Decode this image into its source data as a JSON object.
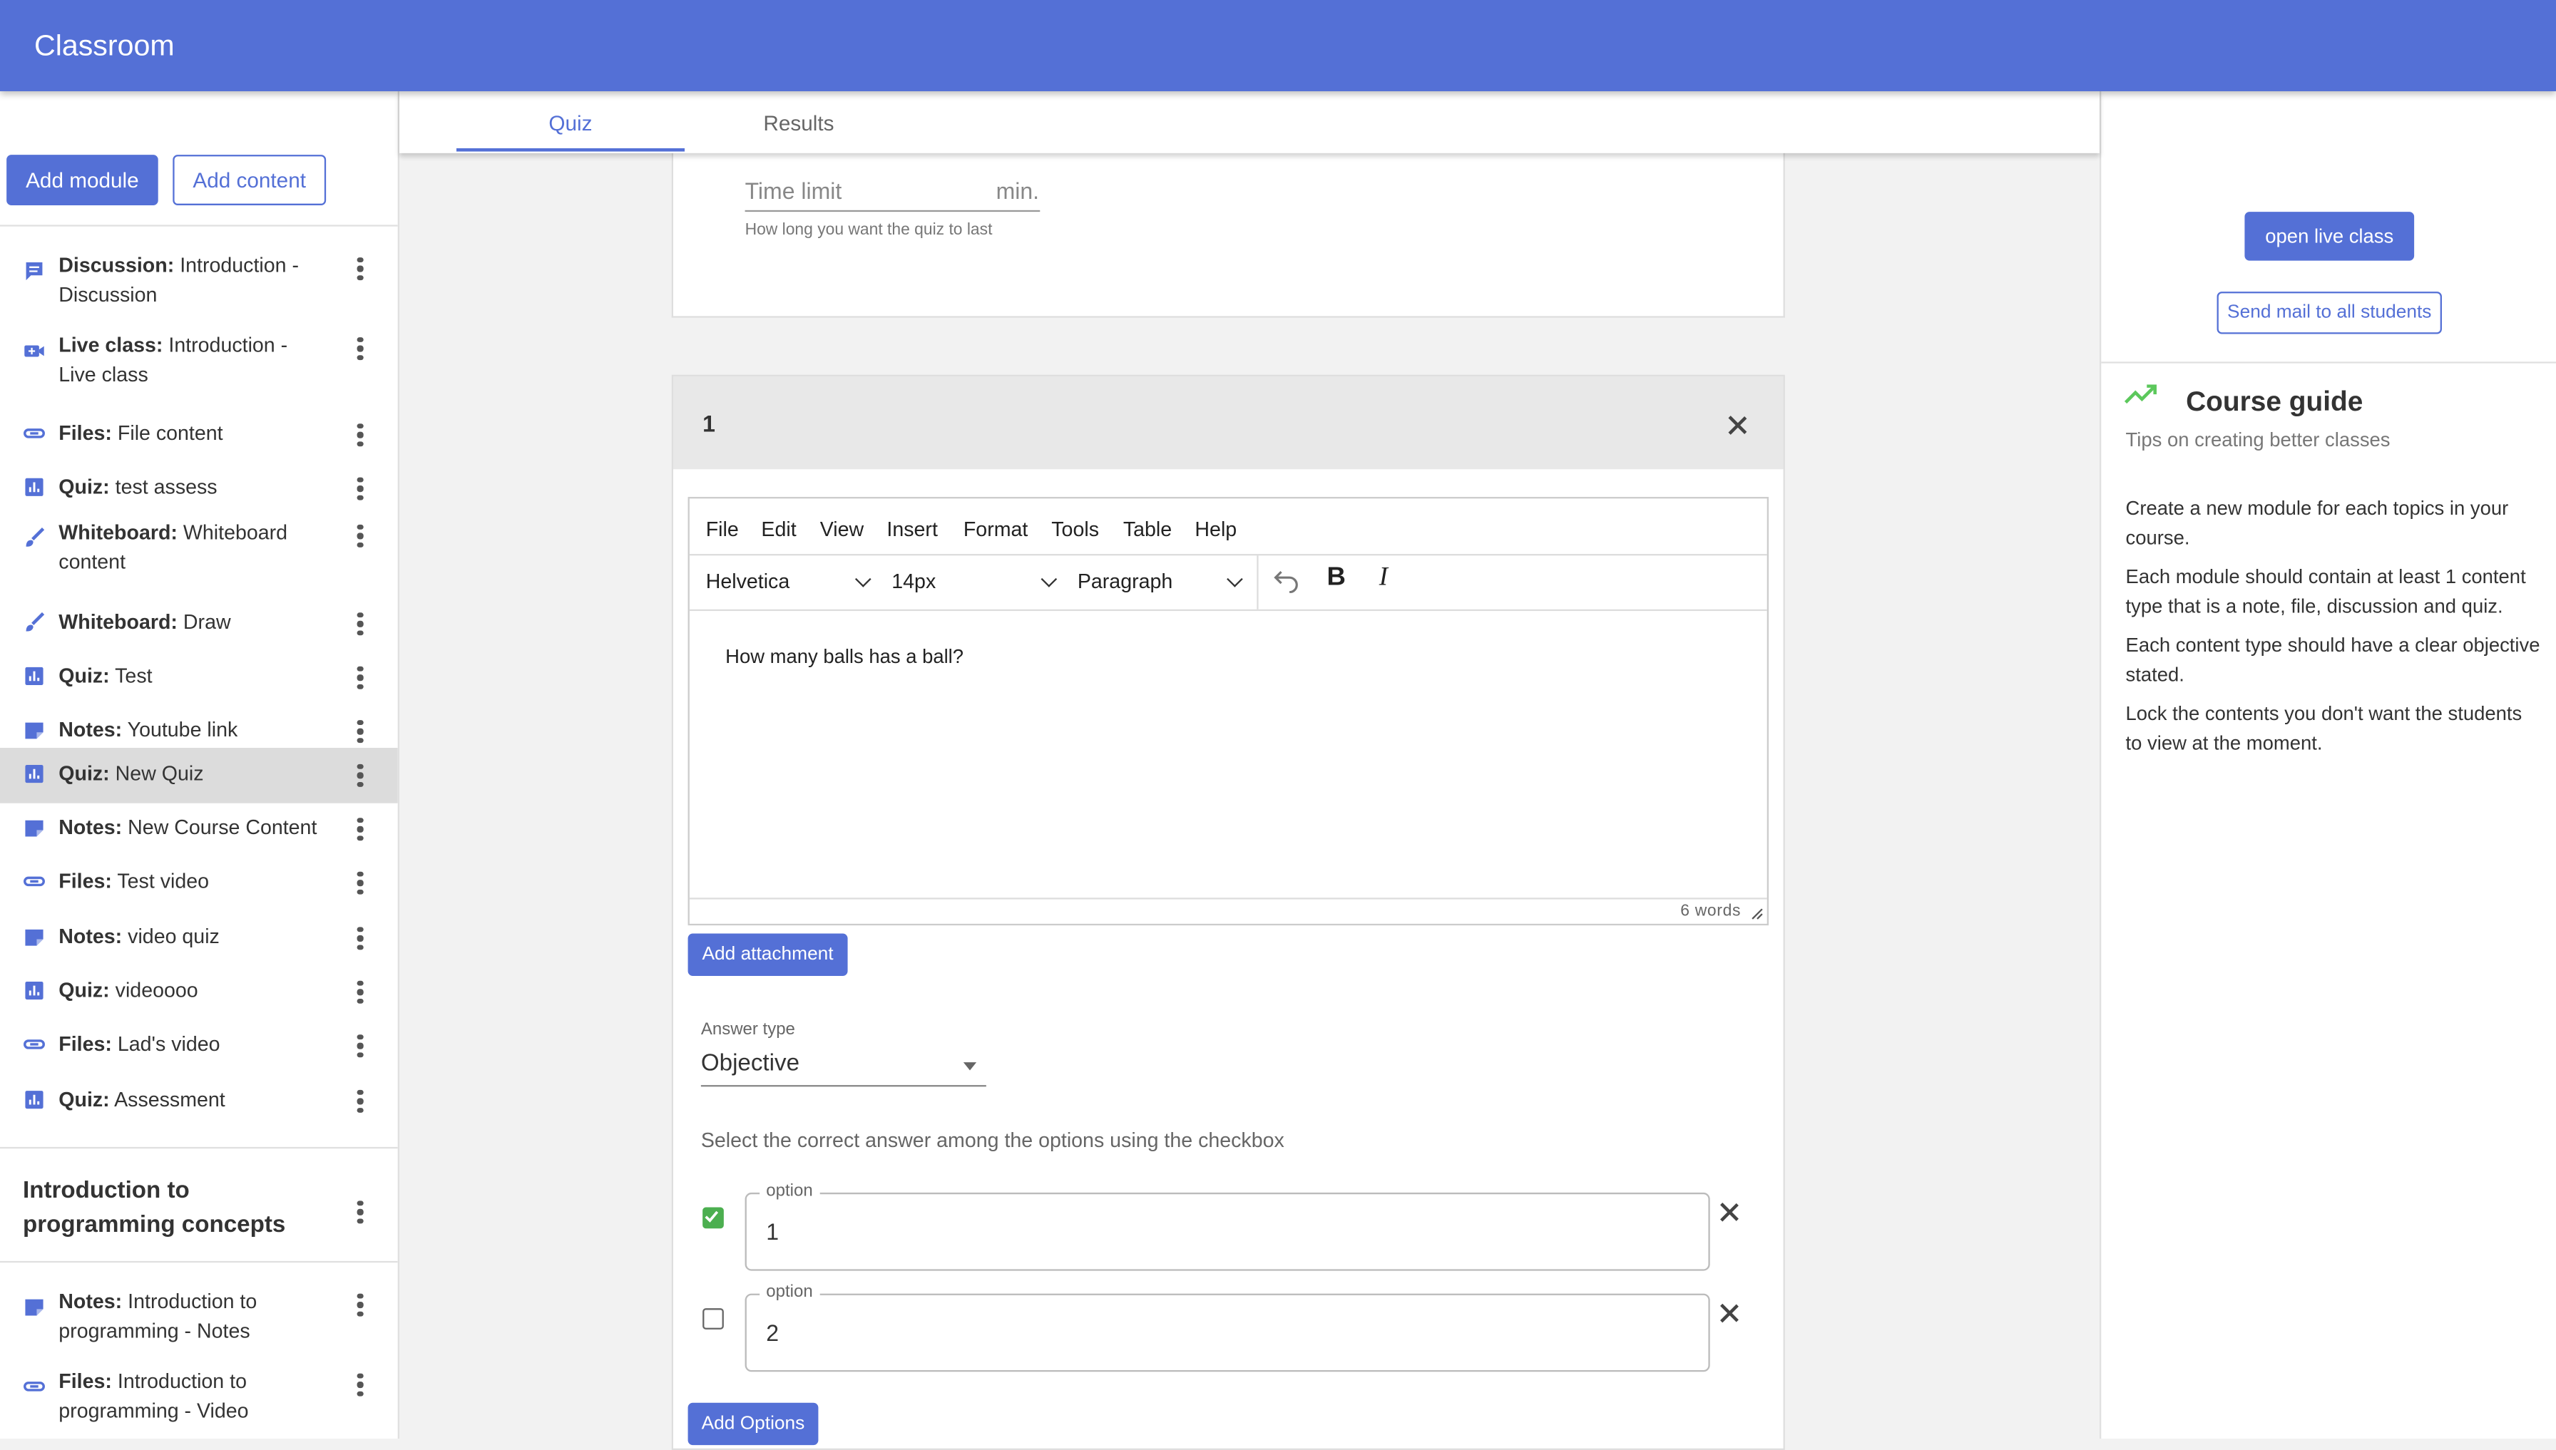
{
  "app": {
    "title": "Classroom"
  },
  "sidebar": {
    "add_module_label": "Add module",
    "add_content_label": "Add content",
    "items": [
      {
        "type": "Discussion:",
        "name": "Introduction - Discussion",
        "icon": "discussion-icon"
      },
      {
        "type": "Live class:",
        "name": "Introduction - Live class",
        "icon": "video-camera-icon"
      },
      {
        "type": "Files:",
        "name": "File content",
        "icon": "link-icon"
      },
      {
        "type": "Quiz:",
        "name": "test assess",
        "icon": "chart-icon"
      },
      {
        "type": "Whiteboard:",
        "name": "Whiteboard content",
        "icon": "brush-icon"
      },
      {
        "type": "Whiteboard:",
        "name": "Draw",
        "icon": "brush-icon"
      },
      {
        "type": "Quiz:",
        "name": "Test",
        "icon": "chart-icon"
      },
      {
        "type": "Notes:",
        "name": "Youtube link",
        "icon": "note-icon"
      },
      {
        "type": "Quiz:",
        "name": "New Quiz",
        "icon": "chart-icon",
        "active": true
      },
      {
        "type": "Notes:",
        "name": "New Course Content",
        "icon": "note-icon"
      },
      {
        "type": "Files:",
        "name": "Test video",
        "icon": "link-icon"
      },
      {
        "type": "Notes:",
        "name": "video quiz",
        "icon": "note-icon"
      },
      {
        "type": "Quiz:",
        "name": "videoooo",
        "icon": "chart-icon"
      },
      {
        "type": "Files:",
        "name": "Lad's video",
        "icon": "link-icon"
      },
      {
        "type": "Quiz:",
        "name": "Assessment",
        "icon": "chart-icon"
      }
    ],
    "module_title": "Introduction to programming concepts",
    "module_items": [
      {
        "type": "Notes:",
        "name": "Introduction to programming - Notes",
        "icon": "note-icon"
      },
      {
        "type": "Files:",
        "name": "Introduction to programming - Video",
        "icon": "link-icon"
      }
    ]
  },
  "tabs": [
    {
      "label": "Quiz",
      "active": true
    },
    {
      "label": "Results",
      "active": false
    }
  ],
  "quiz_settings": {
    "time_limit_placeholder": "Time limit",
    "time_unit": "min.",
    "time_limit_help": "How long you want the quiz to last"
  },
  "question": {
    "number": "1",
    "editor": {
      "menu": [
        "File",
        "Edit",
        "View",
        "Insert",
        "Format",
        "Tools",
        "Table",
        "Help"
      ],
      "font_family": "Helvetica",
      "font_size": "14px",
      "block_format": "Paragraph",
      "content": "How many balls has a ball?",
      "word_count": "6 words"
    },
    "add_attachment_label": "Add attachment",
    "answer_type_label": "Answer type",
    "answer_type_value": "Objective",
    "instructions": "Select the correct answer among the options using the checkbox",
    "options": [
      {
        "legend": "option",
        "value": "1",
        "checked": true
      },
      {
        "legend": "option",
        "value": "2",
        "checked": false
      }
    ],
    "add_options_label": "Add Options"
  },
  "right_panel": {
    "open_live_class_label": "open live class",
    "send_mail_label": "Send mail to all students",
    "guide_title": "Course guide",
    "guide_subtitle": "Tips on creating better classes",
    "tips": [
      "Create a new module for each topics in your course.",
      "Each module should contain at least 1 content type that is a note, file, discussion and quiz.",
      "Each content type should have a clear objective stated.",
      "Lock the contents you don't want the students to view at the moment."
    ]
  },
  "colors": {
    "primary": "#5470d6",
    "success": "#4caf50",
    "guide_icon": "#5cc85c"
  }
}
